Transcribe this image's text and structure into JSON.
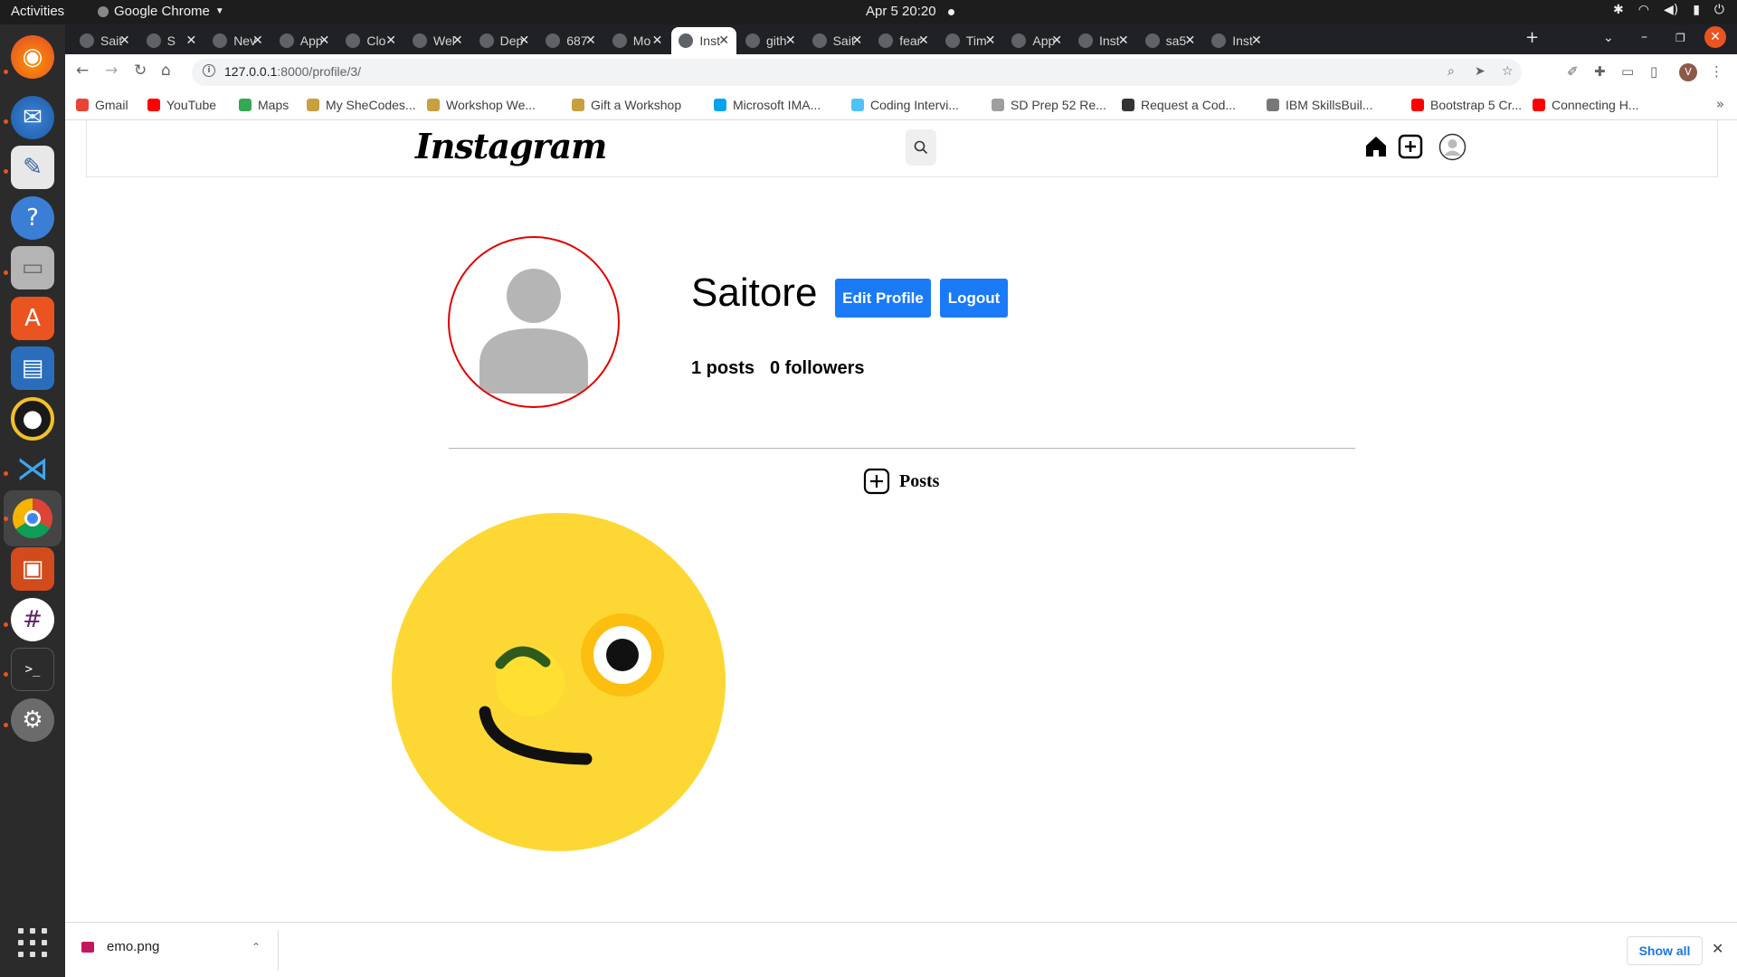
{
  "system_bar": {
    "activities": "Activities",
    "app_name": "Google Chrome",
    "clock": "Apr 5  20:20"
  },
  "dock": {
    "items": [
      "firefox-icon",
      "thunderbird-icon",
      "text-editor-icon",
      "help-icon",
      "files-icon",
      "software-center-icon",
      "writer-icon",
      "rhythmbox-icon",
      "vscode-icon",
      "chrome-icon",
      "impress-icon",
      "slack-icon",
      "terminal-icon",
      "settings-icon"
    ],
    "active": "chrome-icon"
  },
  "tabs": [
    {
      "label": "Sait",
      "active": false
    },
    {
      "label": "S",
      "active": false
    },
    {
      "label": "Nev",
      "active": false
    },
    {
      "label": "App",
      "active": false
    },
    {
      "label": "Clo",
      "active": false
    },
    {
      "label": "Wel",
      "active": false
    },
    {
      "label": "Dep",
      "active": false
    },
    {
      "label": "687",
      "active": false
    },
    {
      "label": "Mo",
      "active": false
    },
    {
      "label": "Inst",
      "active": true
    },
    {
      "label": "gith",
      "active": false
    },
    {
      "label": "Sait",
      "active": false
    },
    {
      "label": "fear",
      "active": false
    },
    {
      "label": "Tim",
      "active": false
    },
    {
      "label": "App",
      "active": false
    },
    {
      "label": "Inst",
      "active": false
    },
    {
      "label": "sa5",
      "active": false
    },
    {
      "label": "Inst",
      "active": false
    }
  ],
  "address_bar": {
    "host": "127.0.0.1",
    "path": ":8000/profile/3/"
  },
  "bookmarks": [
    {
      "label": "Gmail",
      "color": "#ea4335"
    },
    {
      "label": "YouTube",
      "color": "#ff0000"
    },
    {
      "label": "Maps",
      "color": "#34a853"
    },
    {
      "label": "My SheCodes...",
      "color": "#c8a040"
    },
    {
      "label": "Workshop We...",
      "color": "#c8a040"
    },
    {
      "label": "Gift a Workshop",
      "color": "#c8a040"
    },
    {
      "label": "Microsoft IMA...",
      "color": "#00a4ef"
    },
    {
      "label": "Coding Intervi...",
      "color": "#4fc3f7"
    },
    {
      "label": "SD Prep 52 Re...",
      "color": "#9e9e9e"
    },
    {
      "label": "Request a Cod...",
      "color": "#333333"
    },
    {
      "label": "IBM SkillsBuil...",
      "color": "#777777"
    },
    {
      "label": "Bootstrap 5 Cr...",
      "color": "#ff0000"
    },
    {
      "label": "Connecting H...",
      "color": "#ff0000"
    }
  ],
  "instagram": {
    "logo": "Instagram",
    "username": "Saitore",
    "edit_profile": "Edit Profile",
    "logout": "Logout",
    "posts_count": "1 posts",
    "followers_count": "0 followers",
    "posts_tab": "Posts",
    "accent": "#1a7af8",
    "avatar_ring_color": "#e00000"
  },
  "downloads": {
    "file_name": "emo.png",
    "show_all": "Show all"
  }
}
